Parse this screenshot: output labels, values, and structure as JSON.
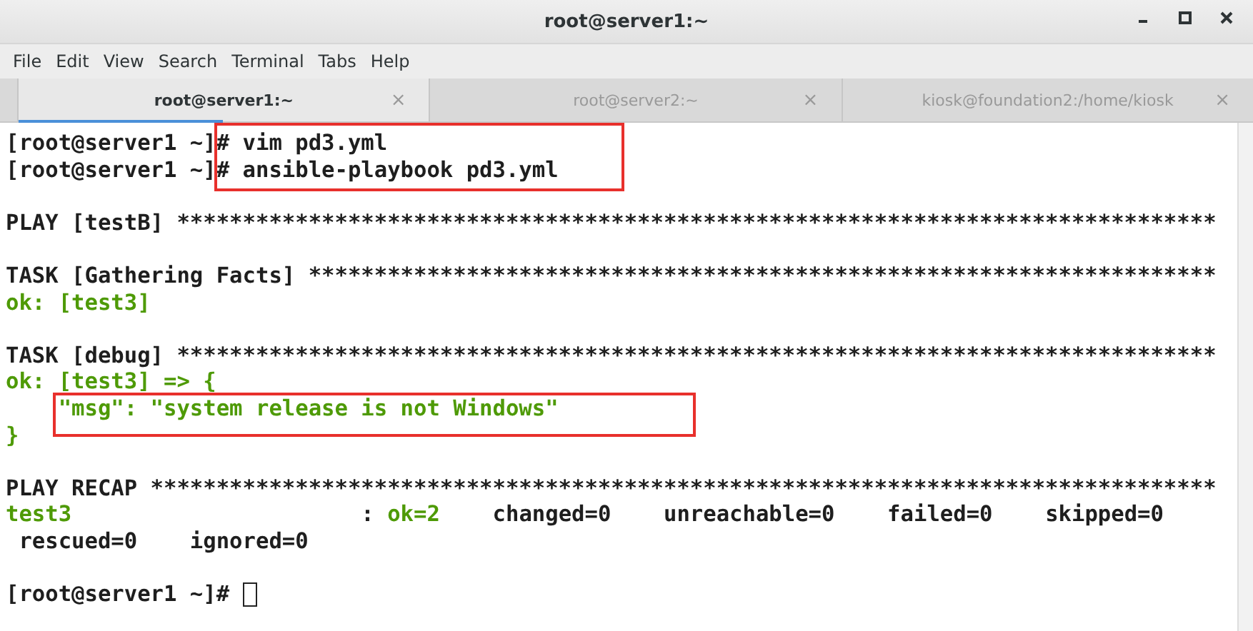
{
  "window": {
    "title": "root@server1:~"
  },
  "menu": [
    "File",
    "Edit",
    "View",
    "Search",
    "Terminal",
    "Tabs",
    "Help"
  ],
  "tabs": [
    {
      "label": "root@server1:~",
      "selected": true,
      "close": "×"
    },
    {
      "label": "root@server2:~",
      "selected": false,
      "close": "×"
    },
    {
      "label": "kiosk@foundation2:/home/kiosk",
      "selected": false,
      "close": "×"
    }
  ],
  "terminal": {
    "lines": [
      {
        "kind": "text",
        "segments": [
          {
            "text": "[root@server1 ~]# vim pd3.yml",
            "kind": "plain"
          }
        ]
      },
      {
        "kind": "text",
        "segments": [
          {
            "text": "[root@server1 ~]# ansible-playbook pd3.yml",
            "kind": "plain"
          }
        ]
      },
      {
        "kind": "blank"
      },
      {
        "kind": "text",
        "segments": [
          {
            "text": "PLAY [testB] *******************************************************************************",
            "kind": "plain"
          }
        ]
      },
      {
        "kind": "blank"
      },
      {
        "kind": "text",
        "segments": [
          {
            "text": "TASK [Gathering Facts] *********************************************************************",
            "kind": "plain"
          }
        ]
      },
      {
        "kind": "text",
        "segments": [
          {
            "text": "ok: [test3]",
            "kind": "ok"
          }
        ]
      },
      {
        "kind": "blank"
      },
      {
        "kind": "text",
        "segments": [
          {
            "text": "TASK [debug] *******************************************************************************",
            "kind": "plain"
          }
        ]
      },
      {
        "kind": "text",
        "segments": [
          {
            "text": "ok: [test3] => {",
            "kind": "ok"
          }
        ]
      },
      {
        "kind": "text",
        "segments": [
          {
            "text": "    \"msg\": \"system release is not Windows\"",
            "kind": "ok"
          }
        ]
      },
      {
        "kind": "text",
        "segments": [
          {
            "text": "}",
            "kind": "ok"
          }
        ]
      },
      {
        "kind": "blank"
      },
      {
        "kind": "text",
        "segments": [
          {
            "text": "PLAY RECAP *********************************************************************************",
            "kind": "plain"
          }
        ]
      },
      {
        "kind": "text",
        "segments": [
          {
            "text": "test3",
            "kind": "ok"
          },
          {
            "text": "                      : ",
            "kind": "plain"
          },
          {
            "text": "ok=2",
            "kind": "ok"
          },
          {
            "text": "    changed=0    unreachable=0    failed=0    skipped=0",
            "kind": "plain"
          }
        ]
      },
      {
        "kind": "text",
        "segments": [
          {
            "text": " rescued=0    ignored=0",
            "kind": "plain"
          }
        ]
      },
      {
        "kind": "blank"
      },
      {
        "kind": "prompt",
        "segments": [
          {
            "text": "[root@server1 ~]# ",
            "kind": "plain"
          }
        ]
      }
    ]
  }
}
